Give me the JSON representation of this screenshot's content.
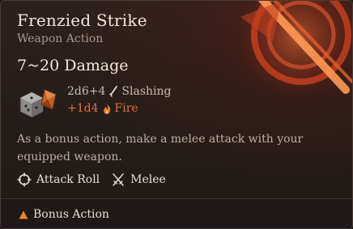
{
  "tooltip": {
    "title": "Frenzied Strike",
    "subtitle": "Weapon Action",
    "damage_total": "7~20 Damage",
    "damage_lines": [
      {
        "dice": "2d6+4",
        "type": "Slashing"
      },
      {
        "dice": "+1d4",
        "type": "Fire"
      }
    ],
    "description": "As a bonus action, make a melee attack with your equipped weapon.",
    "properties": [
      {
        "label": "Attack Roll",
        "icon": "crosshair-icon"
      },
      {
        "label": "Melee",
        "icon": "crossed-swords-icon"
      }
    ],
    "footer": {
      "label": "Bonus Action",
      "icon": "triangle-icon"
    }
  },
  "colors": {
    "fire": "#e0703a",
    "accent": "#d4572a",
    "bonus_action": "#e8872e",
    "text_primary": "#f2e8da",
    "text_secondary": "#a8988a"
  }
}
